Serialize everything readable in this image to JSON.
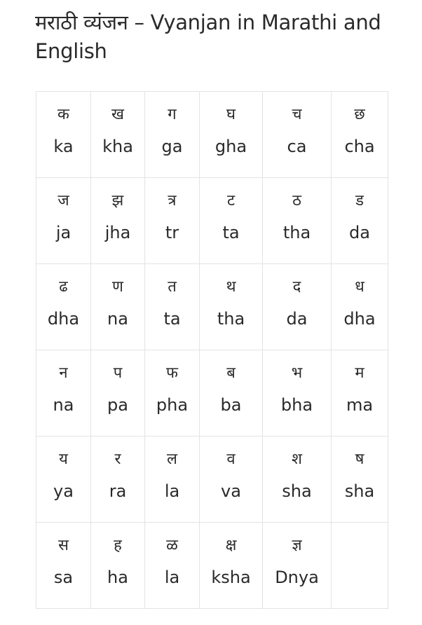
{
  "title": "मराठी व्यंजन – Vyanjan in Marathi and English",
  "table": {
    "rows": [
      [
        {
          "devanagari": "क",
          "latin": "ka"
        },
        {
          "devanagari": "ख",
          "latin": "kha"
        },
        {
          "devanagari": "ग",
          "latin": "ga"
        },
        {
          "devanagari": "घ",
          "latin": "gha"
        },
        {
          "devanagari": "च",
          "latin": "ca"
        },
        {
          "devanagari": "छ",
          "latin": "cha"
        }
      ],
      [
        {
          "devanagari": "ज",
          "latin": "ja"
        },
        {
          "devanagari": "झ",
          "latin": "jha"
        },
        {
          "devanagari": "त्र",
          "latin": "tr"
        },
        {
          "devanagari": "ट",
          "latin": "ta"
        },
        {
          "devanagari": "ठ",
          "latin": "tha"
        },
        {
          "devanagari": "ड",
          "latin": "da"
        }
      ],
      [
        {
          "devanagari": "ढ",
          "latin": "dha"
        },
        {
          "devanagari": "ण",
          "latin": "na"
        },
        {
          "devanagari": "त",
          "latin": "ta"
        },
        {
          "devanagari": "थ",
          "latin": "tha"
        },
        {
          "devanagari": "द",
          "latin": "da"
        },
        {
          "devanagari": "ध",
          "latin": "dha"
        }
      ],
      [
        {
          "devanagari": "न",
          "latin": "na"
        },
        {
          "devanagari": "प",
          "latin": "pa"
        },
        {
          "devanagari": "फ",
          "latin": "pha"
        },
        {
          "devanagari": "ब",
          "latin": "ba"
        },
        {
          "devanagari": "भ",
          "latin": "bha"
        },
        {
          "devanagari": "म",
          "latin": "ma"
        }
      ],
      [
        {
          "devanagari": "य",
          "latin": "ya"
        },
        {
          "devanagari": "र",
          "latin": "ra"
        },
        {
          "devanagari": "ल",
          "latin": "la"
        },
        {
          "devanagari": "व",
          "latin": "va"
        },
        {
          "devanagari": "श",
          "latin": "sha"
        },
        {
          "devanagari": "ष",
          "latin": "sha"
        }
      ],
      [
        {
          "devanagari": "स",
          "latin": "sa"
        },
        {
          "devanagari": "ह",
          "latin": "ha"
        },
        {
          "devanagari": "ळ",
          "latin": "la"
        },
        {
          "devanagari": "क्ष",
          "latin": "ksha"
        },
        {
          "devanagari": "ज्ञ",
          "latin": "Dnya"
        },
        {
          "devanagari": "",
          "latin": ""
        }
      ]
    ]
  }
}
